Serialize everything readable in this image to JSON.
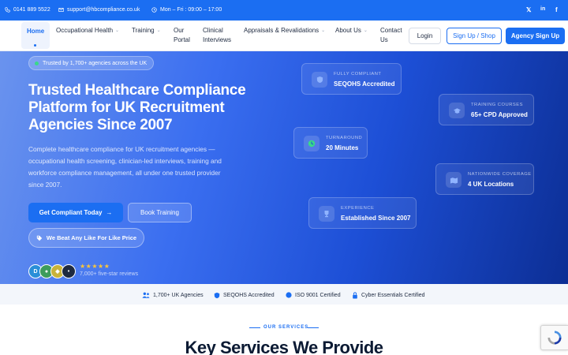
{
  "topbar": {
    "phone": "0141 889 5522",
    "email": "support@hbcompliance.co.uk",
    "hours": "Mon – Fri : 09:00 – 17:00",
    "social": [
      "x-icon",
      "linkedin-icon",
      "facebook-icon"
    ]
  },
  "nav": {
    "items": [
      "Home",
      "Occupational Health",
      "Training",
      "Our Portal",
      "Clinical Interviews",
      "Appraisals & Revalidations",
      "About Us",
      "Contact Us"
    ],
    "login": "Login",
    "signup": "Sign Up / Shop",
    "agency_signup": "Agency Sign Up"
  },
  "hero": {
    "trusted": "Trusted by 1,700+ agencies across the UK",
    "title": "Trusted Healthcare Compliance Platform for UK Recruitment Agencies Since 2007",
    "description": "Complete healthcare compliance for UK recruitment agencies — occupational health screening, clinician-led interviews, training and workforce compliance management, all under one trusted provider since 2007.",
    "cta": "Get Compliant Today",
    "book": "Book Training",
    "beat": "We Beat Any Like For Like Price",
    "stars": "★★★★★",
    "reviews": "7,000+ five-star reviews",
    "cards": [
      {
        "label": "FULLY COMPLIANT",
        "value": "SEQOHS Accredited",
        "icon": "shield-icon"
      },
      {
        "label": "TRAINING COURSES",
        "value": "65+ CPD Approved",
        "icon": "graduation-cap-icon"
      },
      {
        "label": "TURNAROUND",
        "value": "20 Minutes",
        "icon": "clock-icon"
      },
      {
        "label": "NATIONWIDE COVERAGE",
        "value": "4 UK Locations",
        "icon": "map-icon"
      },
      {
        "label": "EXPERIENCE",
        "value": "Established Since 2007",
        "icon": "trophy-icon"
      }
    ]
  },
  "strip": [
    {
      "text": "1,700+ UK Agencies",
      "icon": "users-icon"
    },
    {
      "text": "SEQOHS Accredited",
      "icon": "shield-icon"
    },
    {
      "text": "ISO 9001 Certified",
      "icon": "certificate-icon"
    },
    {
      "text": "Cyber Essentials Certified",
      "icon": "lock-icon"
    }
  ],
  "services": {
    "eyebrow": "OUR SERVICES",
    "title": "Key Services We Provide"
  },
  "colors": {
    "primary": "#1b6ef2",
    "hero_start": "#6a93ee",
    "hero_end": "#0c2e94",
    "star": "#ffc738"
  }
}
